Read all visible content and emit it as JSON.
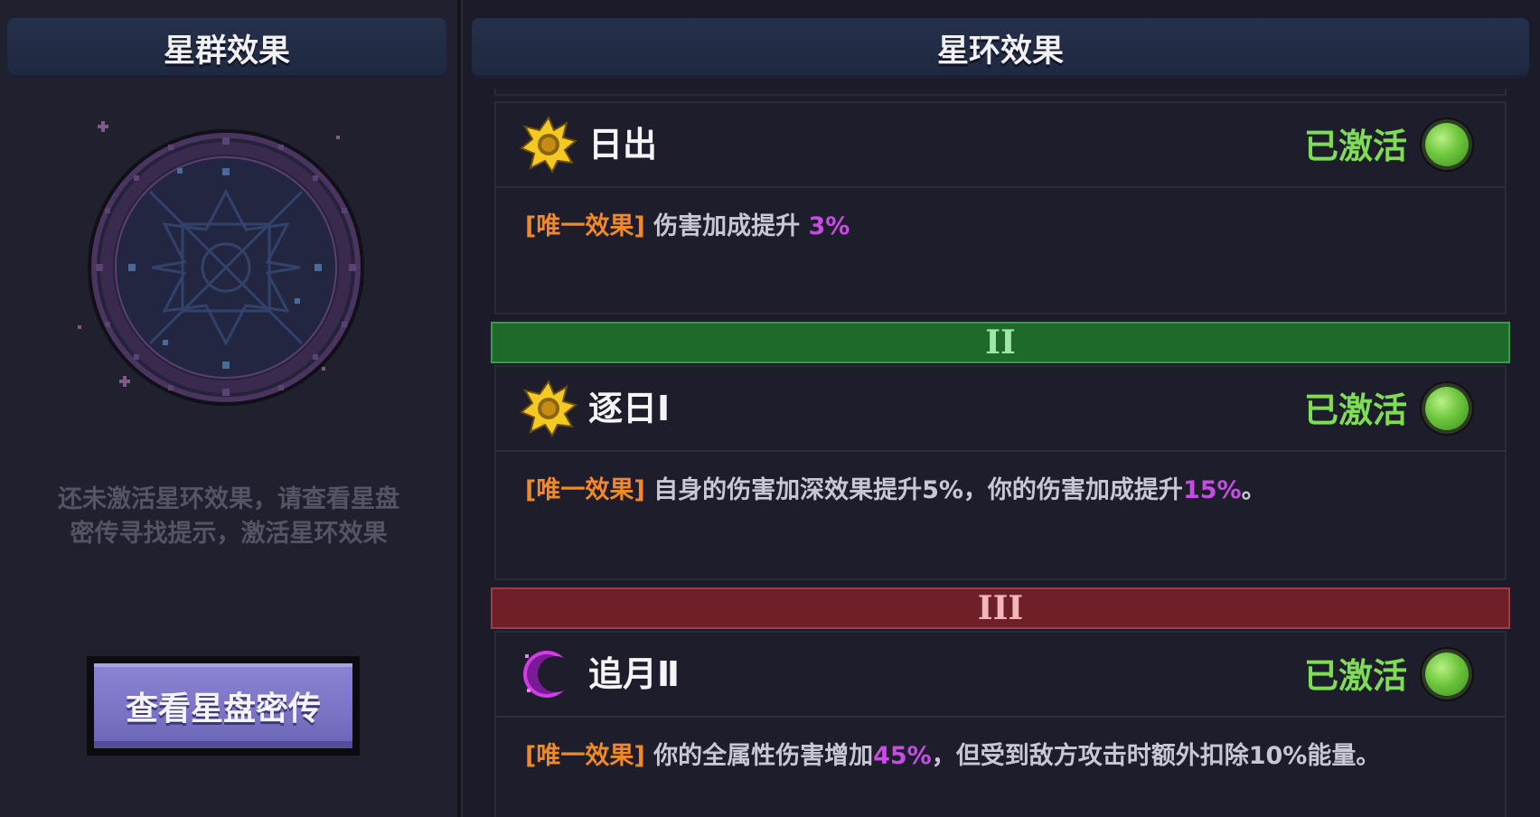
{
  "left_panel": {
    "header": "星群效果",
    "hint_line1": "还未激活星环效果，请查看星盘",
    "hint_line2": "密传寻找提示，激活星环效果",
    "button": "查看星盘密传"
  },
  "right_panel": {
    "header": "星环效果",
    "effects": [
      {
        "icon": "sun-icon",
        "title": "日出",
        "status": "已激活",
        "tag": "[唯一效果]",
        "desc_pre": " 伤害加成提升 ",
        "desc_hl": "3%",
        "desc_post": ""
      },
      {
        "icon": "sun-icon",
        "title": "逐日Ⅰ",
        "status": "已激活",
        "tag": "[唯一效果]",
        "desc_pre": " 自身的伤害加深效果提升5%，你的伤害加成提升",
        "desc_hl": "15%",
        "desc_post": "。"
      },
      {
        "icon": "crescent-moon-icon",
        "title": "追月Ⅱ",
        "status": "已激活",
        "tag": "[唯一效果]",
        "desc_pre": " 你的全属性伤害增加",
        "desc_hl": "45%",
        "desc_post": "，但受到敌方攻击时额外扣除10%能量。"
      }
    ],
    "tiers": [
      {
        "label": "II",
        "color": "#1e6a2a"
      },
      {
        "label": "III",
        "color": "#6e1f27"
      }
    ]
  },
  "colors": {
    "active_status": "#7fdc55",
    "unique_tag": "#f08a28",
    "highlight": "#c54de3"
  }
}
